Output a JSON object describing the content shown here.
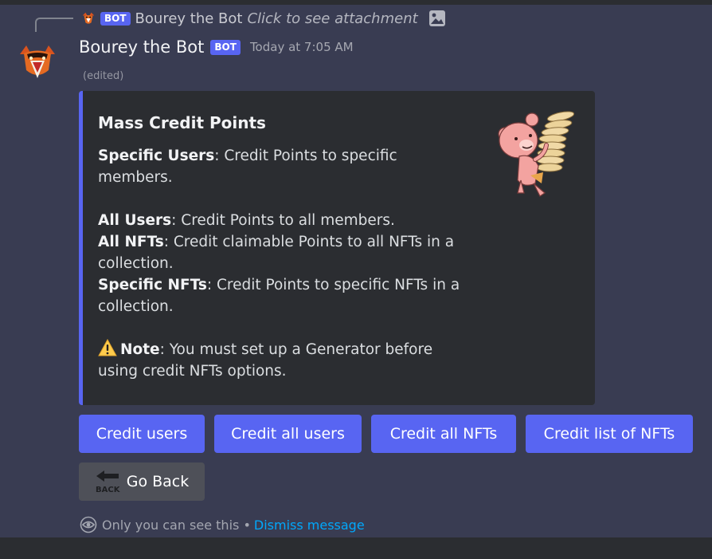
{
  "reply": {
    "bot_tag": "BOT",
    "author": "Bourey the Bot",
    "text": "Click to see attachment",
    "icon": "image-icon"
  },
  "message": {
    "author": "Bourey the Bot",
    "bot_tag": "BOT",
    "timestamp": "Today at 7:05 AM",
    "edited": "(edited)"
  },
  "embed": {
    "accent_color": "#5865f2",
    "title": "Mass Credit Points",
    "specific_users_label": "Specific Users",
    "specific_users_text": ": Credit Points to specific members.",
    "all_users_label": "All Users",
    "all_users_text": ": Credit Points to all members.",
    "all_nfts_label": "All NFTs",
    "all_nfts_text": ": Credit claimable Points to all NFTs in a collection.",
    "specific_nfts_label": "Specific NFTs",
    "specific_nfts_text": ": Credit Points to specific NFTs in a collection.",
    "note_icon": "warning-icon",
    "note_label": "Note",
    "note_text": ": You must set up a Generator before using credit NFTs options.",
    "thumbnail": "bear-carrying-coins"
  },
  "buttons": {
    "credit_users": "Credit users",
    "credit_all_users": "Credit all users",
    "credit_all_nfts": "Credit all NFTs",
    "credit_list_nfts": "Credit list of NFTs",
    "go_back": "Go Back",
    "go_back_icon_text": "BACK"
  },
  "footer": {
    "icon": "eye-icon",
    "text": "Only you can see this •",
    "dismiss": "Dismiss message"
  },
  "colors": {
    "blurple": "#5865f2",
    "link": "#00a8fc",
    "embed_bg": "#2b2d31",
    "secondary_button": "#4e5058"
  }
}
